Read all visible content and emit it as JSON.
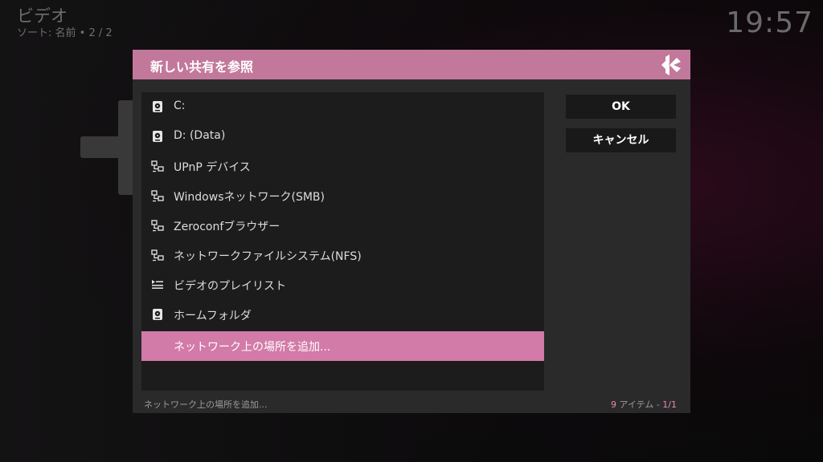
{
  "background": {
    "title": "ビデオ",
    "sort_text": "ソート: 名前  •  2 / 2",
    "clock": "19:57"
  },
  "dialog": {
    "title": "新しい共有を参照",
    "accent_color": "#d27aa8",
    "header_color": "#c2789b",
    "items": [
      {
        "label": "C:",
        "icon": "hard-drive-icon"
      },
      {
        "label": "D: (Data)",
        "icon": "hard-drive-icon"
      },
      {
        "label": "UPnP デバイス",
        "icon": "network-icon"
      },
      {
        "label": "Windowsネットワーク(SMB)",
        "icon": "network-icon"
      },
      {
        "label": "Zeroconfブラウザー",
        "icon": "network-icon"
      },
      {
        "label": "ネットワークファイルシステム(NFS)",
        "icon": "network-icon"
      },
      {
        "label": "ビデオのプレイリスト",
        "icon": "playlist-icon"
      },
      {
        "label": "ホームフォルダ",
        "icon": "hard-drive-icon"
      },
      {
        "label": "ネットワーク上の場所を追加...",
        "icon": "",
        "selected": true
      }
    ],
    "buttons": {
      "ok": "OK",
      "cancel": "キャンセル"
    },
    "footer": {
      "selected_label": "ネットワーク上の場所を追加...",
      "item_count": "9",
      "item_word": " アイテム - ",
      "page": "1/1"
    }
  }
}
